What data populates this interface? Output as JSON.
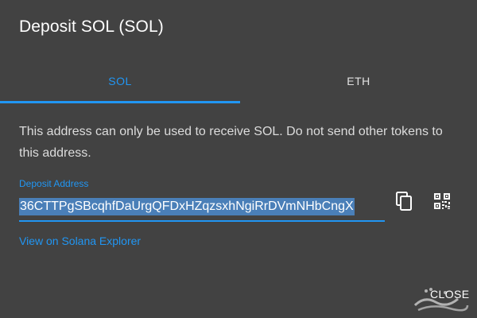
{
  "dialog": {
    "title": "Deposit SOL (SOL)"
  },
  "tabs": [
    {
      "label": "SOL",
      "active": true
    },
    {
      "label": "ETH",
      "active": false
    }
  ],
  "message": "This address can only be used to receive SOL. Do not send other tokens to this address.",
  "deposit_field": {
    "label": "Deposit Address",
    "value": "36CTTPgSBcqhfDaUrgQFDxHZqzsxhNgiRrDVmNHbCngX"
  },
  "icons": {
    "copy": "copy-icon",
    "qr": "qr-code-icon"
  },
  "explorer_link": "View on Solana Explorer",
  "actions": {
    "close_label": "CLOSE"
  },
  "colors": {
    "background": "#424242",
    "accent": "#2196f3",
    "text": "#ffffff",
    "selection": "#4a7fb8"
  }
}
